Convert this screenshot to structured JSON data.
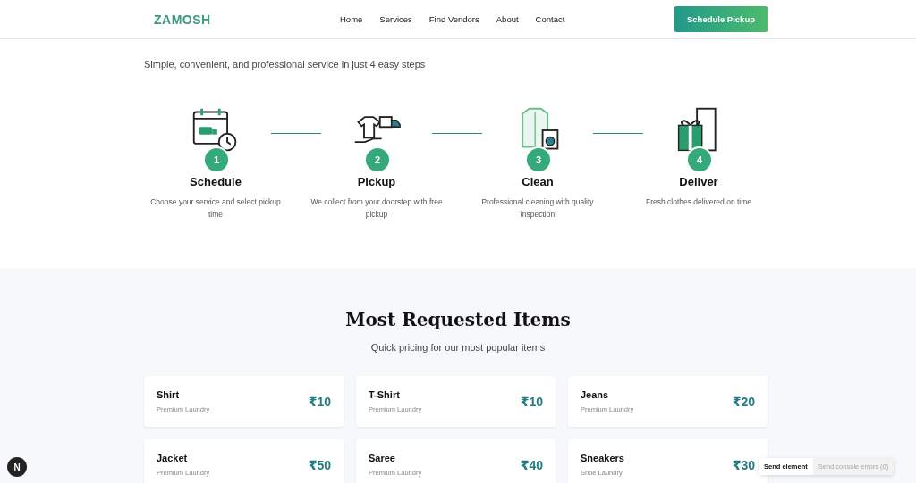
{
  "header": {
    "logo": "ZAMOSH",
    "nav": [
      {
        "label": "Home"
      },
      {
        "label": "Services"
      },
      {
        "label": "Find Vendors"
      },
      {
        "label": "About"
      },
      {
        "label": "Contact"
      }
    ],
    "cta": "Schedule Pickup"
  },
  "how": {
    "subtitle": "Simple, convenient, and professional service in just 4 easy steps",
    "steps": [
      {
        "number": "1",
        "title": "Schedule",
        "text": "Choose your service and select pickup time"
      },
      {
        "number": "2",
        "title": "Pickup",
        "text": "We collect from your doorstep with free pickup"
      },
      {
        "number": "3",
        "title": "Clean",
        "text": "Professional cleaning with quality inspection"
      },
      {
        "number": "4",
        "title": "Deliver",
        "text": "Fresh clothes delivered on time"
      }
    ]
  },
  "items": {
    "title": "Most Requested Items",
    "subtitle": "Quick pricing for our most popular items",
    "cards": [
      {
        "name": "Shirt",
        "service": "Premium Laundry",
        "price": "₹10"
      },
      {
        "name": "T-Shirt",
        "service": "Premium Laundry",
        "price": "₹10"
      },
      {
        "name": "Jeans",
        "service": "Premium Laundry",
        "price": "₹20"
      },
      {
        "name": "Jacket",
        "service": "Premium Laundry",
        "price": "₹50"
      },
      {
        "name": "Saree",
        "service": "Premium Laundry",
        "price": "₹40"
      },
      {
        "name": "Sneakers",
        "service": "Shoe Laundry",
        "price": "₹30"
      }
    ]
  },
  "devtools": {
    "badge": "N",
    "send_element": "Send element",
    "send_errors": "Send console errors (0)"
  }
}
